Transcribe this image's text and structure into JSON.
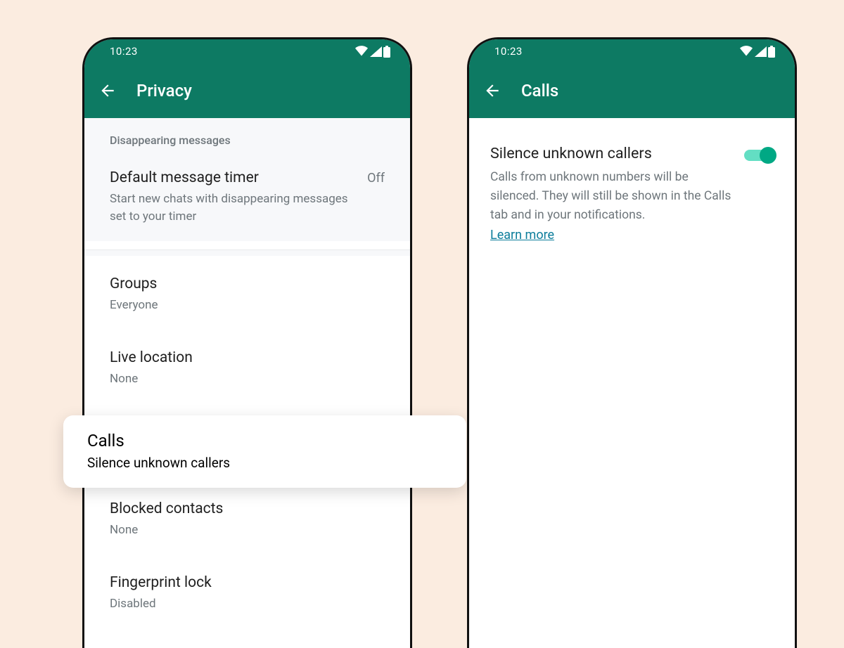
{
  "status": {
    "time": "10:23"
  },
  "left": {
    "appbar_title": "Privacy",
    "section_label": "Disappearing messages",
    "timer": {
      "title": "Default message timer",
      "value": "Off",
      "sub": "Start new chats with disappearing messages set to your timer"
    },
    "groups": {
      "title": "Groups",
      "sub": "Everyone"
    },
    "live": {
      "title": "Live location",
      "sub": "None"
    },
    "calls": {
      "title": "Calls",
      "sub": "Silence unknown callers"
    },
    "blocked": {
      "title": "Blocked contacts",
      "sub": "None"
    },
    "finger": {
      "title": "Fingerprint lock",
      "sub": "Disabled"
    }
  },
  "right": {
    "appbar_title": "Calls",
    "setting_title": "Silence unknown callers",
    "setting_desc": "Calls from unknown numbers will be silenced. They will still be shown in the Calls tab and in your notifications.",
    "learn_more": "Learn more",
    "toggle_on": true
  }
}
